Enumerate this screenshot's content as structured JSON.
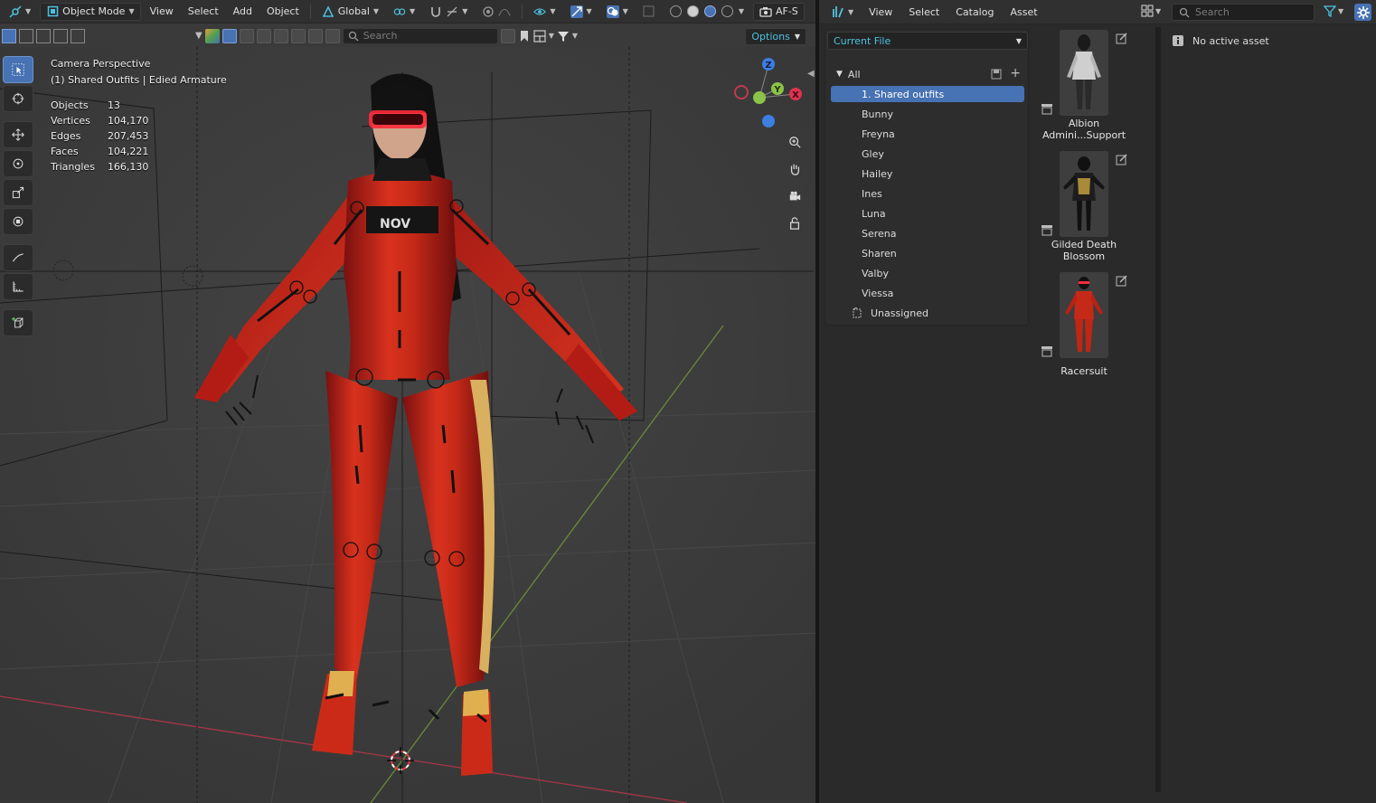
{
  "viewport": {
    "header": {
      "editor_type_icon": "3d-viewport-icon",
      "mode_label": "Object Mode",
      "menus": [
        "View",
        "Select",
        "Add",
        "Object"
      ],
      "orientation_label": "Global",
      "camera_label": "AF-S"
    },
    "tool_header": {
      "search_placeholder": "Search",
      "options_label": "Options"
    },
    "overlay": {
      "view_name": "Camera Perspective",
      "collection_line": "(1) Shared Outfits | Edied Armature",
      "stats": [
        {
          "label": "Objects",
          "value": "13"
        },
        {
          "label": "Vertices",
          "value": "104,170"
        },
        {
          "label": "Edges",
          "value": "207,453"
        },
        {
          "label": "Faces",
          "value": "104,221"
        },
        {
          "label": "Triangles",
          "value": "166,130"
        }
      ]
    },
    "gizmo_axes": [
      "Z",
      "Y",
      "X"
    ],
    "colors": {
      "x_axis": "#e0334f",
      "y_axis": "#8bc34a",
      "z_axis": "#3d7ee0",
      "accent": "#4772b3",
      "highlight_text": "#4dc2e0"
    }
  },
  "asset_browser": {
    "header": {
      "menus": [
        "View",
        "Select",
        "Catalog",
        "Asset"
      ],
      "search_placeholder": "Search"
    },
    "library_label": "Current File",
    "catalog": {
      "root_label": "All",
      "selected": "1. Shared outfits",
      "children": [
        "Bunny",
        "Freyna",
        "Gley",
        "Hailey",
        "Ines",
        "Luna",
        "Serena",
        "Sharen",
        "Valby",
        "Viessa"
      ],
      "unassigned_label": "Unassigned"
    },
    "assets": [
      {
        "name_line1": "Albion",
        "name_line2": "Admini...Support"
      },
      {
        "name_line1": "Gilded Death",
        "name_line2": "Blossom"
      },
      {
        "name_line1": "Racersuit",
        "name_line2": ""
      }
    ],
    "details_text": "No active asset"
  }
}
